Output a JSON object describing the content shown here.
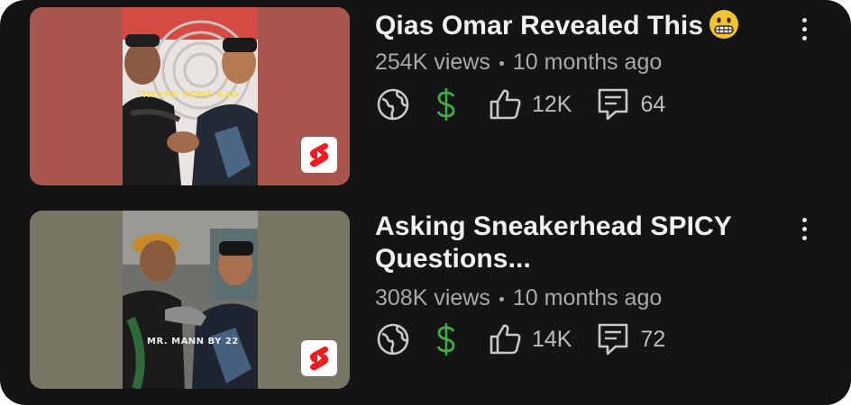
{
  "videos": [
    {
      "title": "Qias Omar Revealed This",
      "title_emoji": "grimacing-face",
      "views": "254K views",
      "age": "10 months ago",
      "likes": "12K",
      "comments": "64",
      "thumbnail_caption": "THEYRE SOME BAD",
      "thumb_bg": "#a9574e",
      "monetization_color": "#3fae49"
    },
    {
      "title_line1": "Asking Sneakerhead SPICY",
      "title_line2": "Questions...",
      "views": "308K views",
      "age": "10 months ago",
      "likes": "14K",
      "comments": "72",
      "thumbnail_caption": "MR. MANN BY 22",
      "thumb_bg": "#787565",
      "monetization_color": "#3fae49"
    }
  ],
  "icons": {
    "globe": "globe-icon",
    "dollar": "dollar-icon",
    "like": "thumbs-up-icon",
    "comment": "comment-icon",
    "more": "more-vertical-icon",
    "shorts": "shorts-icon"
  }
}
